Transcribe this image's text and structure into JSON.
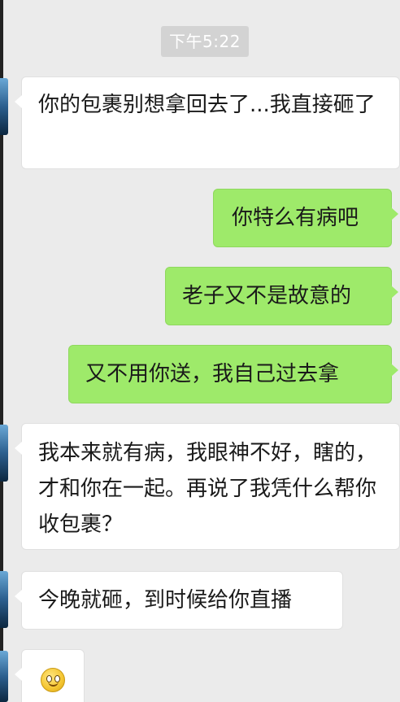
{
  "timestamp": "下午5:22",
  "messages": [
    {
      "side": "left",
      "text": "你的包裹别想拿回去了...我直接砸了"
    },
    {
      "side": "right",
      "text": "你特么有病吧"
    },
    {
      "side": "right",
      "text": "老子又不是故意的"
    },
    {
      "side": "right",
      "text": "又不用你送，我自己过去拿"
    },
    {
      "side": "left",
      "text": "我本来就有病，我眼神不好，瞎的，才和你在一起。再说了我凭什么帮你收包裹？"
    },
    {
      "side": "left",
      "text": "今晚就砸，到时候给你直播"
    },
    {
      "side": "left",
      "emoji": "smile-emoji"
    }
  ],
  "colors": {
    "background": "#ebebeb",
    "incoming_bubble": "#ffffff",
    "outgoing_bubble": "#9eea6a",
    "timestamp_pill": "#d3d3d3"
  }
}
